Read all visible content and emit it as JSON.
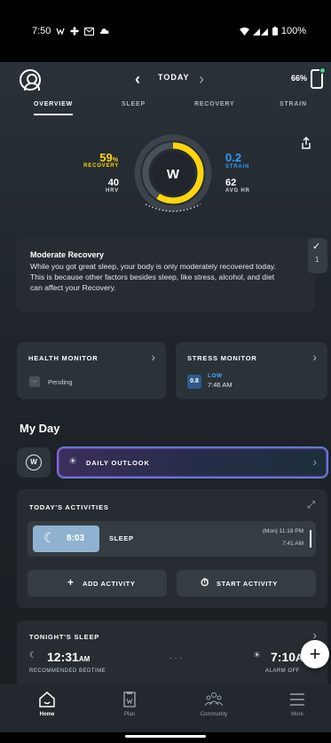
{
  "status_bar": {
    "time": "7:50",
    "battery": "100%"
  },
  "header": {
    "date_label": "TODAY",
    "strap_battery": "66%"
  },
  "tabs": [
    {
      "label": "OVERVIEW",
      "active": true
    },
    {
      "label": "SLEEP",
      "active": false
    },
    {
      "label": "RECOVERY",
      "active": false
    },
    {
      "label": "STRAIN",
      "active": false
    }
  ],
  "overview": {
    "recovery_value": "59",
    "recovery_unit": "%",
    "recovery_label": "RECOVERY",
    "recovery_fraction": 0.59,
    "hrv_value": "40",
    "hrv_label": "HRV",
    "strain_value": "0.2",
    "strain_label": "STRAIN",
    "avg_hr_value": "62",
    "avg_hr_label": "AVG HR",
    "gauge_logo": "W"
  },
  "insight": {
    "title": "Moderate Recovery",
    "body": "While you got great sleep, your body is only moderately recovered today. This is because other factors besides sleep, like stress, alcohol, and diet can affect your Recovery.",
    "count": "1"
  },
  "health_monitor": {
    "title": "HEALTH MONITOR",
    "status": "Pending",
    "badge": "–"
  },
  "stress_monitor": {
    "title": "STRESS MONITOR",
    "value": "0.8",
    "level": "LOW",
    "time": "7:46 AM"
  },
  "my_day": {
    "title": "My Day",
    "w_button": "W",
    "outlook_label": "DAILY OUTLOOK"
  },
  "activities": {
    "title": "TODAY'S ACTIVITIES",
    "items": [
      {
        "duration": "8:03",
        "name": "SLEEP",
        "start": "(Mon) 11:18 PM",
        "end": "7:41 AM"
      }
    ],
    "add_label": "ADD ACTIVITY",
    "start_label": "START ACTIVITY"
  },
  "tonight": {
    "title": "TONIGHT'S SLEEP",
    "bedtime": "12:31",
    "bedtime_suffix": "AM",
    "bedtime_label": "RECOMMENDED BEDTIME",
    "separator": "- - -",
    "alarm": "7:10",
    "alarm_suffix": "A",
    "alarm_label": "ALARM OFF"
  },
  "bottom_nav": [
    {
      "label": "Home",
      "icon": "home-icon",
      "active": true
    },
    {
      "label": "Plan",
      "icon": "plan-icon",
      "active": false
    },
    {
      "label": "Community",
      "icon": "community-icon",
      "active": false
    },
    {
      "label": "More",
      "icon": "menu-icon",
      "active": false
    }
  ],
  "colors": {
    "recovery_yellow": "#ffd60a",
    "strain_blue": "#2f9bff",
    "stress_blue": "#4ea3ff",
    "sleep_pill": "#8fb2d1"
  }
}
